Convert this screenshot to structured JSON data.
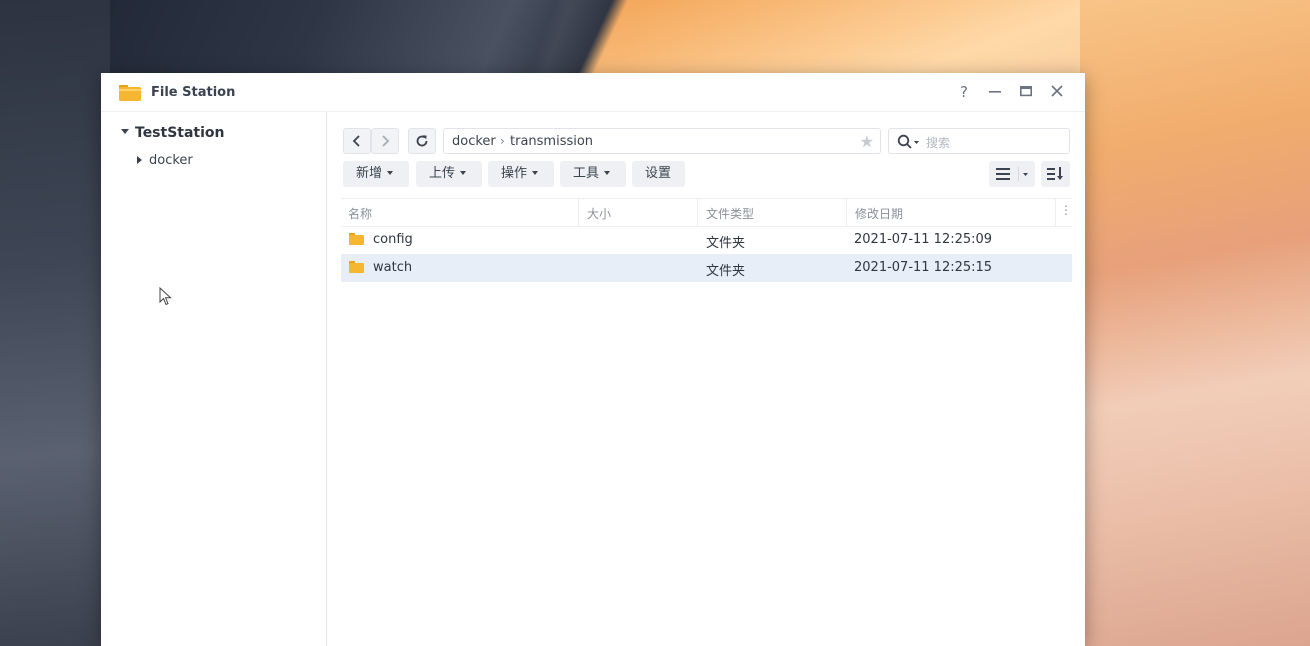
{
  "window": {
    "title": "File Station",
    "controls": {
      "help": "?",
      "minimize": "—",
      "maximize": "▭",
      "close": "✕"
    }
  },
  "sidebar": {
    "root": "TestStation",
    "children": [
      "docker"
    ]
  },
  "nav": {
    "back": "‹",
    "forward": "›",
    "refresh": "↻",
    "path": [
      "docker",
      "transmission"
    ],
    "path_separator": "›",
    "search_placeholder": "搜索"
  },
  "toolbar": {
    "create": "新增",
    "upload": "上传",
    "action": "操作",
    "tools": "工具",
    "settings": "设置"
  },
  "table": {
    "headers": [
      "名称",
      "大小",
      "文件类型",
      "修改日期"
    ],
    "rows": [
      {
        "name": "config",
        "size": "",
        "type": "文件夹",
        "modified": "2021-07-11 12:25:09",
        "selected": false
      },
      {
        "name": "watch",
        "size": "",
        "type": "文件夹",
        "modified": "2021-07-11 12:25:15",
        "selected": true
      }
    ]
  },
  "colors": {
    "accent": "#f5b731",
    "selected_row": "#e7eef8",
    "button_bg": "#eef0f3"
  }
}
